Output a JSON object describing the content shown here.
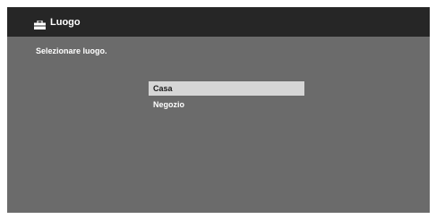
{
  "header": {
    "icon": "toolbox-icon",
    "title": "Luogo"
  },
  "instruction": "Selezionare luogo.",
  "options": [
    {
      "label": "Casa",
      "selected": true
    },
    {
      "label": "Negozio",
      "selected": false
    }
  ],
  "colors": {
    "background": "#6b6b6b",
    "titlebar": "#262626",
    "highlight": "#d6d6d6"
  }
}
